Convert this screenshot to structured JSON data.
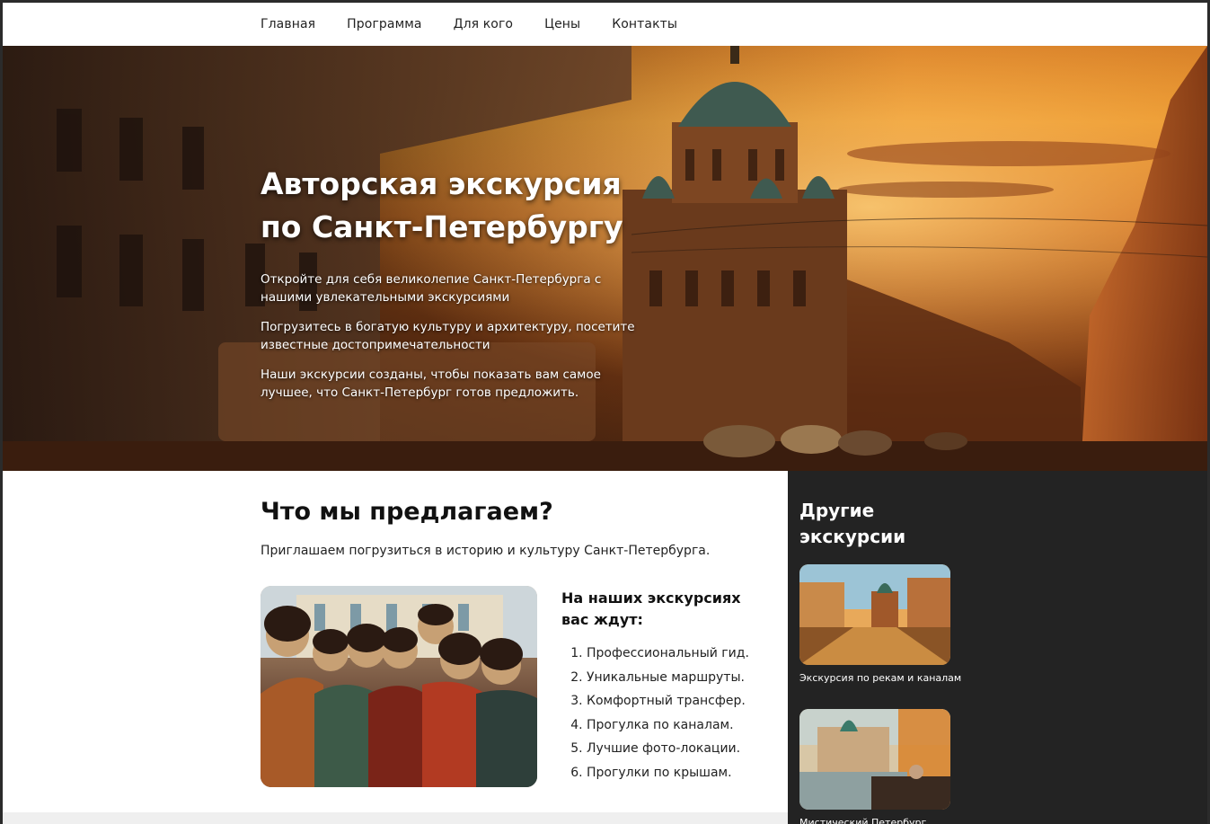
{
  "nav": {
    "items": [
      {
        "label": "Главная"
      },
      {
        "label": "Программа"
      },
      {
        "label": "Для кого"
      },
      {
        "label": "Цены"
      },
      {
        "label": "Контакты"
      }
    ]
  },
  "hero": {
    "title_line1": "Авторская экскурсия",
    "title_line2": "по Санкт-Петербургу",
    "paragraphs": [
      "Откройте для себя великолепие Санкт-Петербурга с нашими увлекательными экскурсиями",
      "Погрузитесь в богатую культуру и архитектуру, посетите известные достопримечательности",
      "Наши экскурсии созданы, чтобы показать вам самое лучшее, что Санкт-Петербург готов предложить."
    ]
  },
  "offer": {
    "title": "Что мы предлагаем?",
    "intro": "Приглашаем погрузиться в историю и культуру Санкт-Петербурга.",
    "await_title": "На наших экскурсиях вас ждут:",
    "items": [
      "Профессиональный гид.",
      "Уникальные маршруты.",
      "Комфортный трансфер.",
      "Прогулка по каналам.",
      "Лучшие фото-локации.",
      "Прогулки по крышам."
    ]
  },
  "sidebar": {
    "title": "Другие экскурсии",
    "cards": [
      {
        "label": "Экскурсия по рекам и каналам"
      },
      {
        "label": "Мистический Петербург"
      }
    ]
  }
}
